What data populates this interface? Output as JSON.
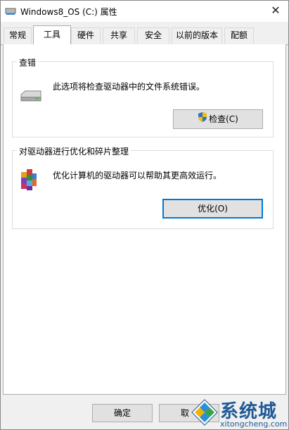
{
  "window": {
    "title": "Windows8_OS (C:) 属性",
    "close_symbol": "✕"
  },
  "tabs": [
    {
      "label": "常规"
    },
    {
      "label": "工具",
      "active": true
    },
    {
      "label": "硬件"
    },
    {
      "label": "共享"
    },
    {
      "label": "安全"
    },
    {
      "label": "以前的版本"
    },
    {
      "label": "配额"
    }
  ],
  "error_checking": {
    "title": "查错",
    "description": "此选项将检查驱动器中的文件系统错误。",
    "button_label": "检查(C)",
    "icon": "drive-icon"
  },
  "optimize": {
    "title": "对驱动器进行优化和碎片整理",
    "description": "优化计算机的驱动器可以帮助其更高效运行。",
    "button_label": "优化(O)",
    "icon": "defrag-icon"
  },
  "footer": {
    "ok_label": "确定",
    "cancel_label": "取"
  },
  "watermark": {
    "brand": "系统城",
    "domain": "xitongcheng.com"
  },
  "colors": {
    "focus": "#0078d7",
    "watermark": "#1f5a96"
  }
}
